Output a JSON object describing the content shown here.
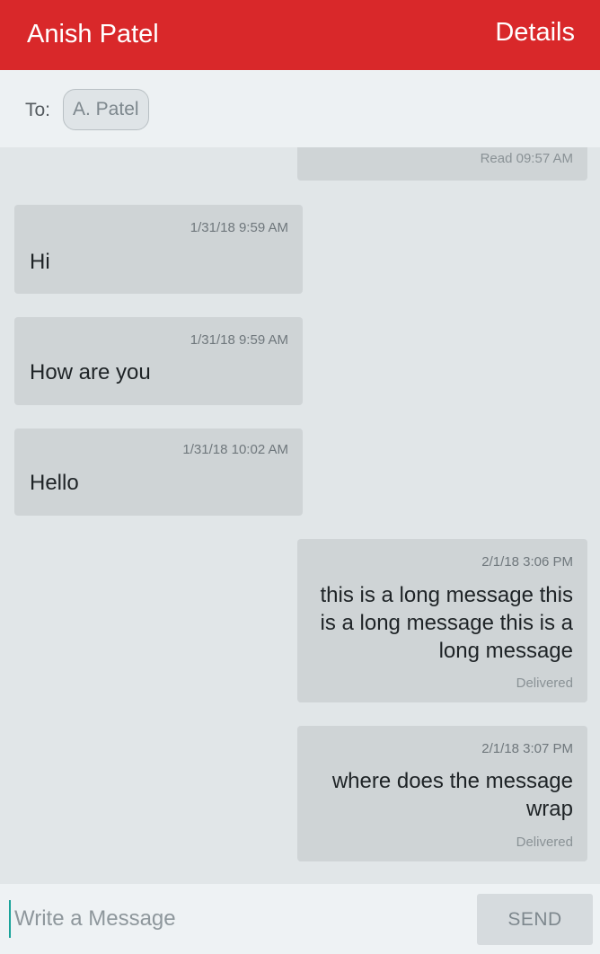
{
  "header": {
    "title": "Anish Patel",
    "details_label": "Details"
  },
  "recipient": {
    "to_label": "To:",
    "chip": "A. Patel"
  },
  "thread": {
    "partial_status": "Read 09:57 AM",
    "messages": [
      {
        "direction": "in",
        "timestamp": "1/31/18 9:59 AM",
        "text": "Hi"
      },
      {
        "direction": "in",
        "timestamp": "1/31/18 9:59 AM",
        "text": "How are you"
      },
      {
        "direction": "in",
        "timestamp": "1/31/18 10:02 AM",
        "text": "Hello"
      },
      {
        "direction": "out",
        "timestamp": "2/1/18 3:06 PM",
        "text": "this is a long message this is a long message this is a long message",
        "status": "Delivered"
      },
      {
        "direction": "out",
        "timestamp": "2/1/18 3:07 PM",
        "text": "where does the message wrap",
        "status": "Delivered"
      }
    ]
  },
  "composer": {
    "placeholder": "Write a Message",
    "value": "",
    "send_label": "SEND"
  },
  "colors": {
    "header": "#d9282a",
    "bubble": "#cfd4d6",
    "cursor": "#1aa39a"
  }
}
